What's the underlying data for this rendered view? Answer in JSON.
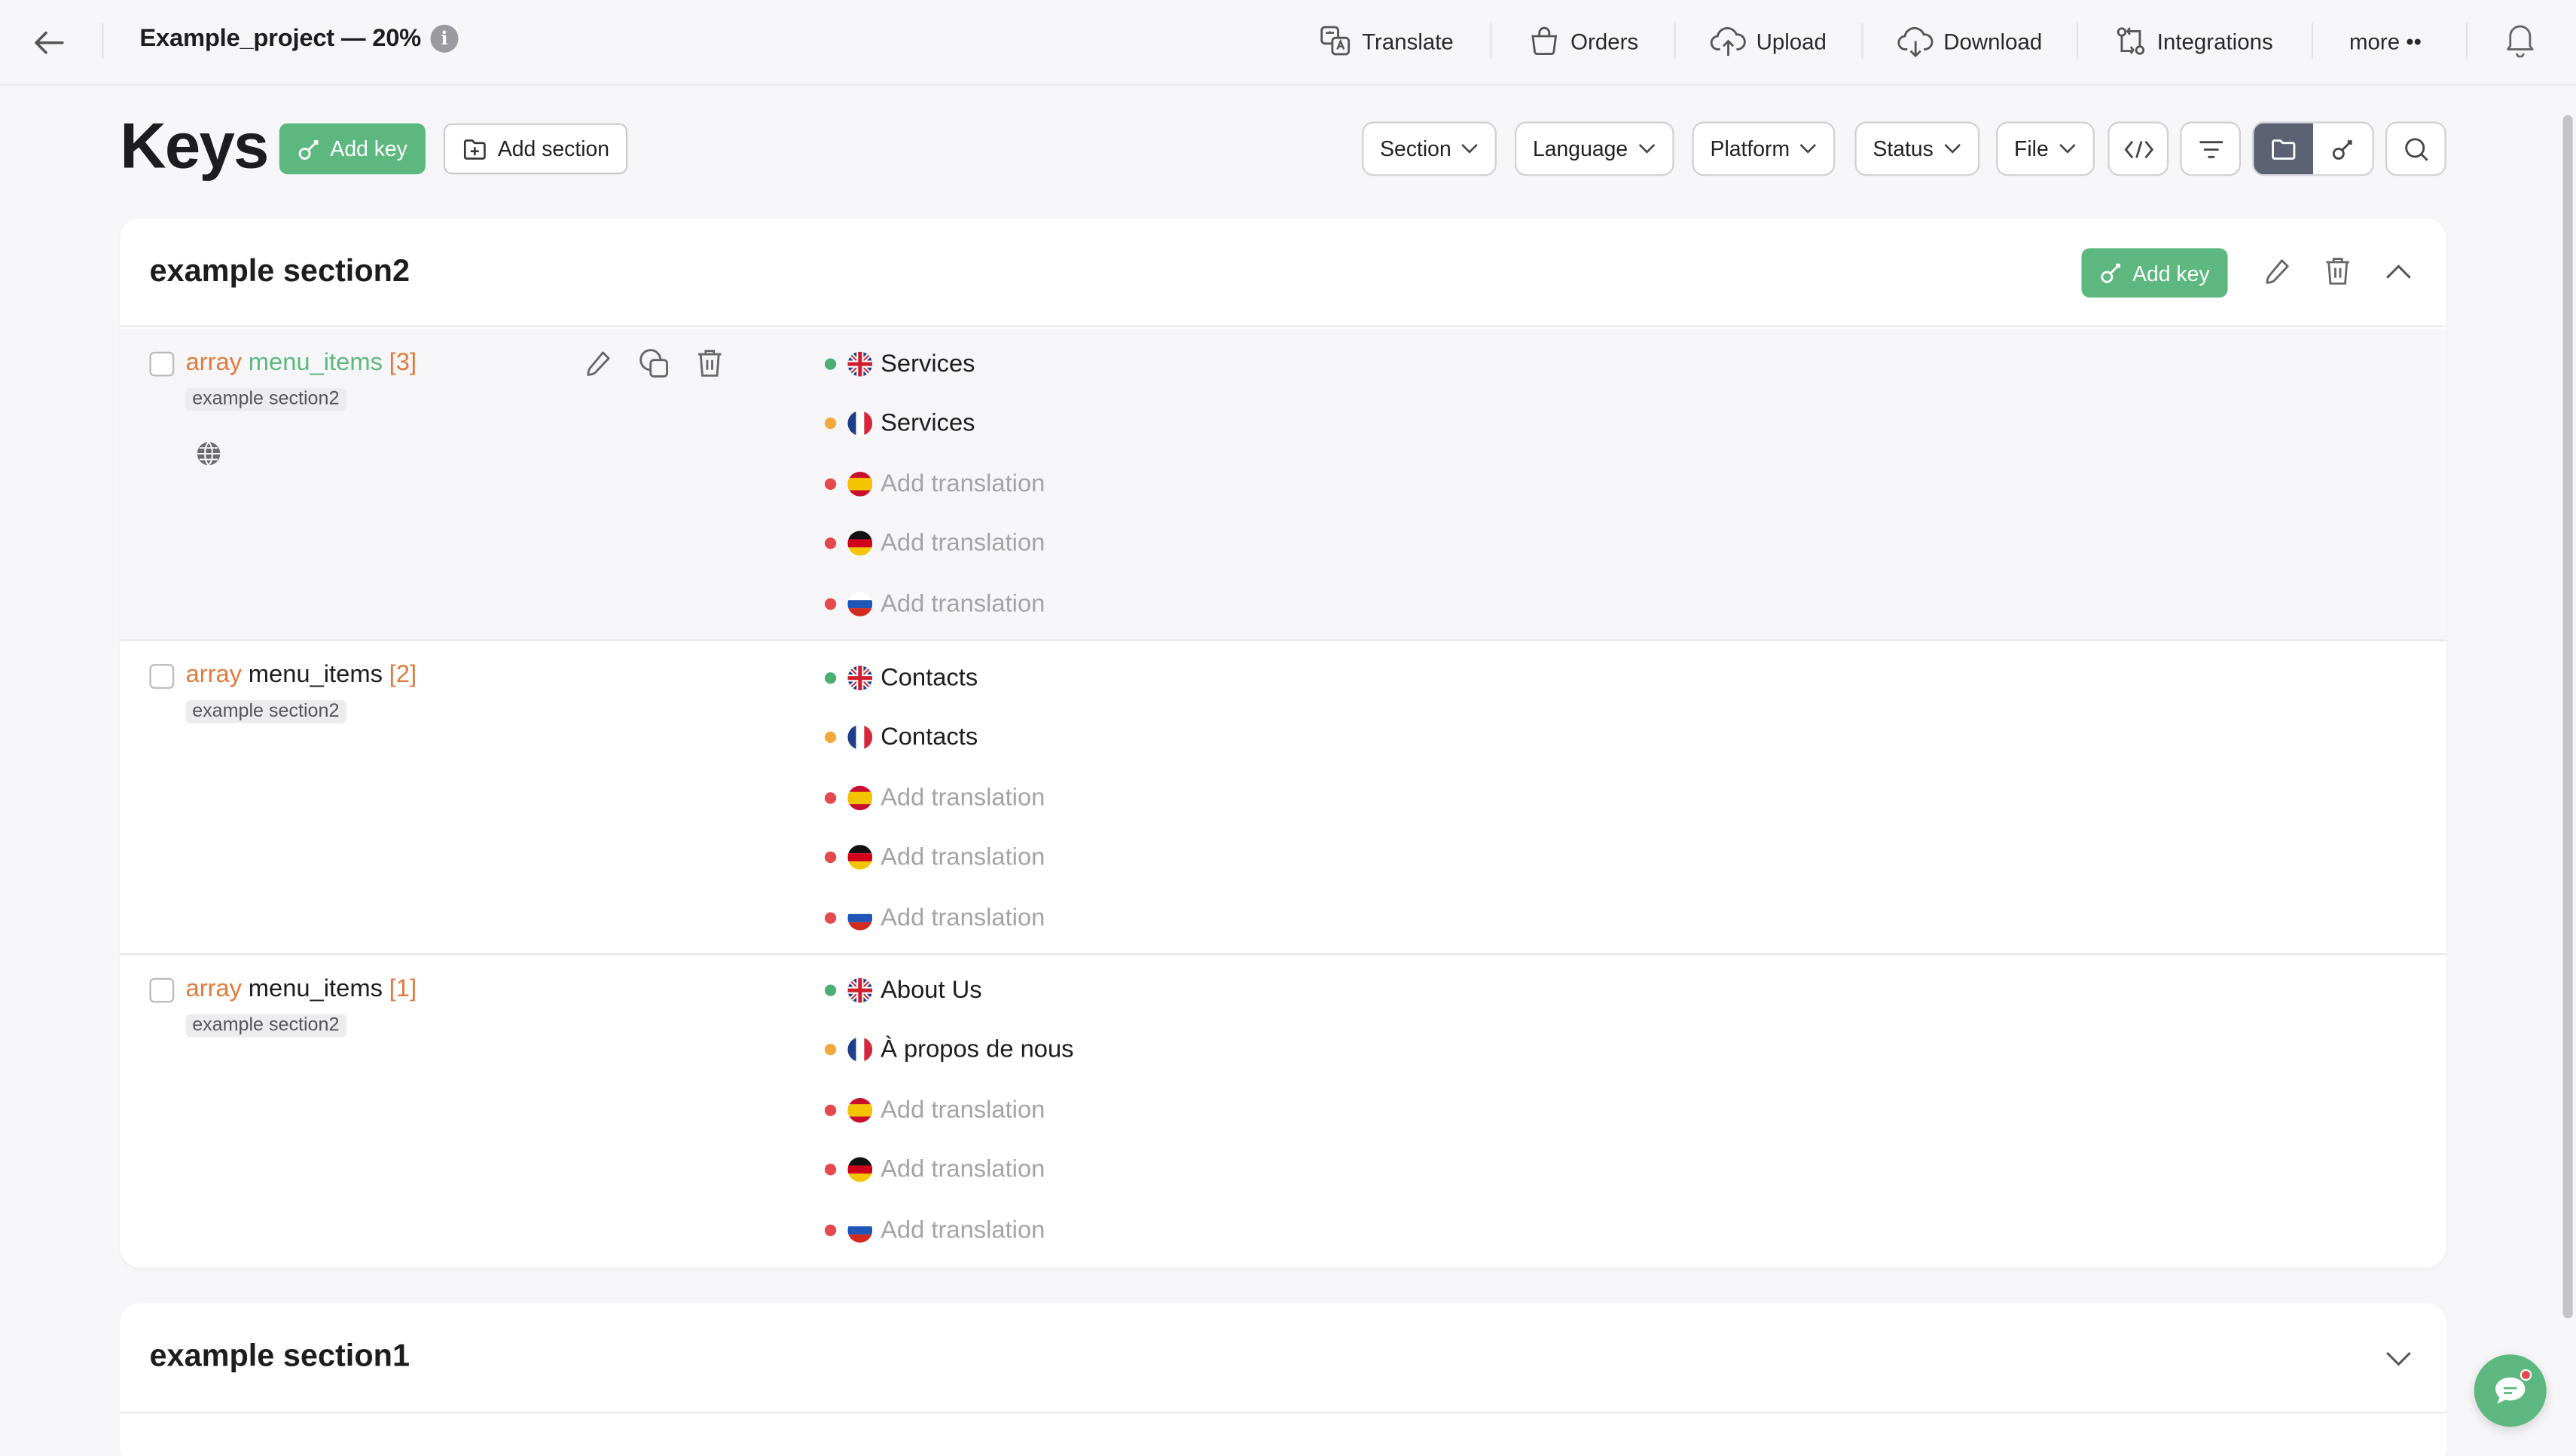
{
  "topbar": {
    "project_title": "Example_project — 20%",
    "info": "i",
    "nav": [
      "Translate",
      "Orders",
      "Upload",
      "Download",
      "Integrations",
      "more ••"
    ]
  },
  "page": {
    "title": "Keys",
    "add_key": "Add key",
    "add_section": "Add section",
    "filters": [
      "Section",
      "Language",
      "Platform",
      "Status",
      "File"
    ]
  },
  "sections": [
    {
      "title": "example section2",
      "add_key": "Add key",
      "rows": [
        {
          "kw": "array",
          "name": "menu_items",
          "index": "[3]",
          "tag": "example section2",
          "translations": [
            {
              "lang": "en",
              "status": "#4caf72",
              "text": "Services",
              "placeholder": false
            },
            {
              "lang": "fr",
              "status": "#f2a93b",
              "text": "Services",
              "placeholder": false
            },
            {
              "lang": "es",
              "status": "#e5484d",
              "text": "Add translation",
              "placeholder": true
            },
            {
              "lang": "de",
              "status": "#e5484d",
              "text": "Add translation",
              "placeholder": true
            },
            {
              "lang": "ru",
              "status": "#e5484d",
              "text": "Add translation",
              "placeholder": true
            }
          ]
        },
        {
          "kw": "array",
          "name": "menu_items",
          "index": "[2]",
          "tag": "example section2",
          "translations": [
            {
              "lang": "en",
              "status": "#4caf72",
              "text": "Contacts",
              "placeholder": false
            },
            {
              "lang": "fr",
              "status": "#f2a93b",
              "text": "Contacts",
              "placeholder": false
            },
            {
              "lang": "es",
              "status": "#e5484d",
              "text": "Add translation",
              "placeholder": true
            },
            {
              "lang": "de",
              "status": "#e5484d",
              "text": "Add translation",
              "placeholder": true
            },
            {
              "lang": "ru",
              "status": "#e5484d",
              "text": "Add translation",
              "placeholder": true
            }
          ]
        },
        {
          "kw": "array",
          "name": "menu_items",
          "index": "[1]",
          "tag": "example section2",
          "translations": [
            {
              "lang": "en",
              "status": "#4caf72",
              "text": "About Us",
              "placeholder": false
            },
            {
              "lang": "fr",
              "status": "#f2a93b",
              "text": "À propos de nous",
              "placeholder": false
            },
            {
              "lang": "es",
              "status": "#e5484d",
              "text": "Add translation",
              "placeholder": true
            },
            {
              "lang": "de",
              "status": "#e5484d",
              "text": "Add translation",
              "placeholder": true
            },
            {
              "lang": "ru",
              "status": "#e5484d",
              "text": "Add translation",
              "placeholder": true
            }
          ]
        }
      ]
    },
    {
      "title": "example section1"
    }
  ],
  "colors": {
    "accent_green": "#5cb87e",
    "key_orange": "#e07a3c",
    "status_done": "#4caf72",
    "status_partial": "#f2a93b",
    "status_missing": "#e5484d"
  }
}
